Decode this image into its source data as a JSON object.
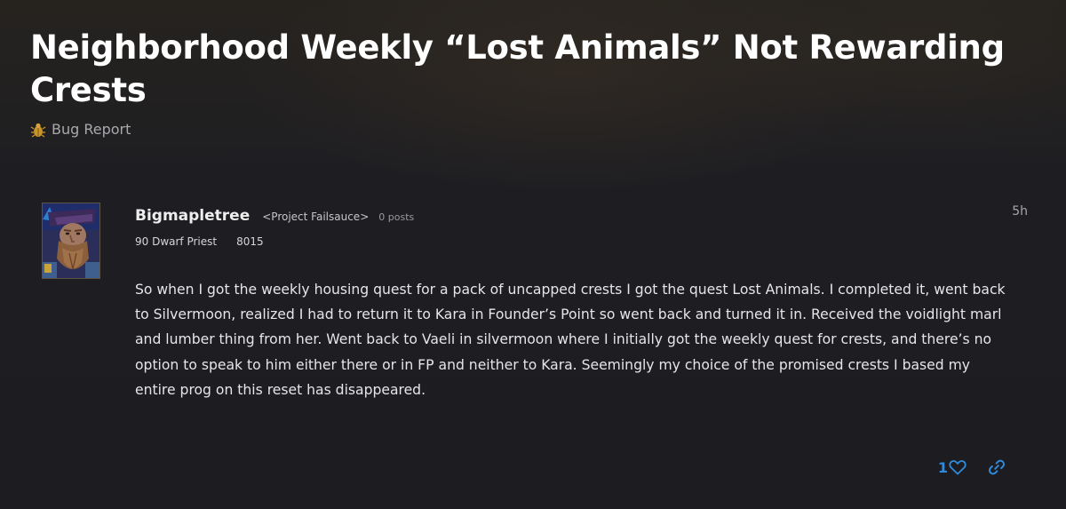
{
  "topic": {
    "title": "Neighborhood Weekly “Lost Animals” Not Rewarding Crests",
    "category": {
      "label": "Bug Report",
      "icon": "bug-icon"
    }
  },
  "post": {
    "author": {
      "username": "Bigmapletree",
      "guild": "<Project Failsauce>",
      "post_count": "0 posts",
      "character": "90 Dwarf Priest",
      "achievement_points": "8015",
      "avatar": "dwarf-priest-portrait"
    },
    "time": "5h",
    "body": "So when I got the weekly housing quest for a pack of uncapped crests I got the quest Lost Animals. I completed it, went back to Silvermoon, realized I had to return it to Kara in Founder’s Point so went back and turned it in. Received the voidlight marl and lumber thing from her. Went back to Vaeli in silvermoon where I initially got the weekly quest for crests, and there’s no option to speak to him either there or in FP and neither to Kara. Seemingly my choice of the promised crests I based my entire prog on this reset has disappeared.",
    "actions": {
      "like_count": "1",
      "like_icon": "heart-icon",
      "share_icon": "link-icon"
    }
  },
  "colors": {
    "accent": "#2f8bde",
    "background": "#1d1d22",
    "title": "#ffffff",
    "muted": "#a9a9ad"
  }
}
